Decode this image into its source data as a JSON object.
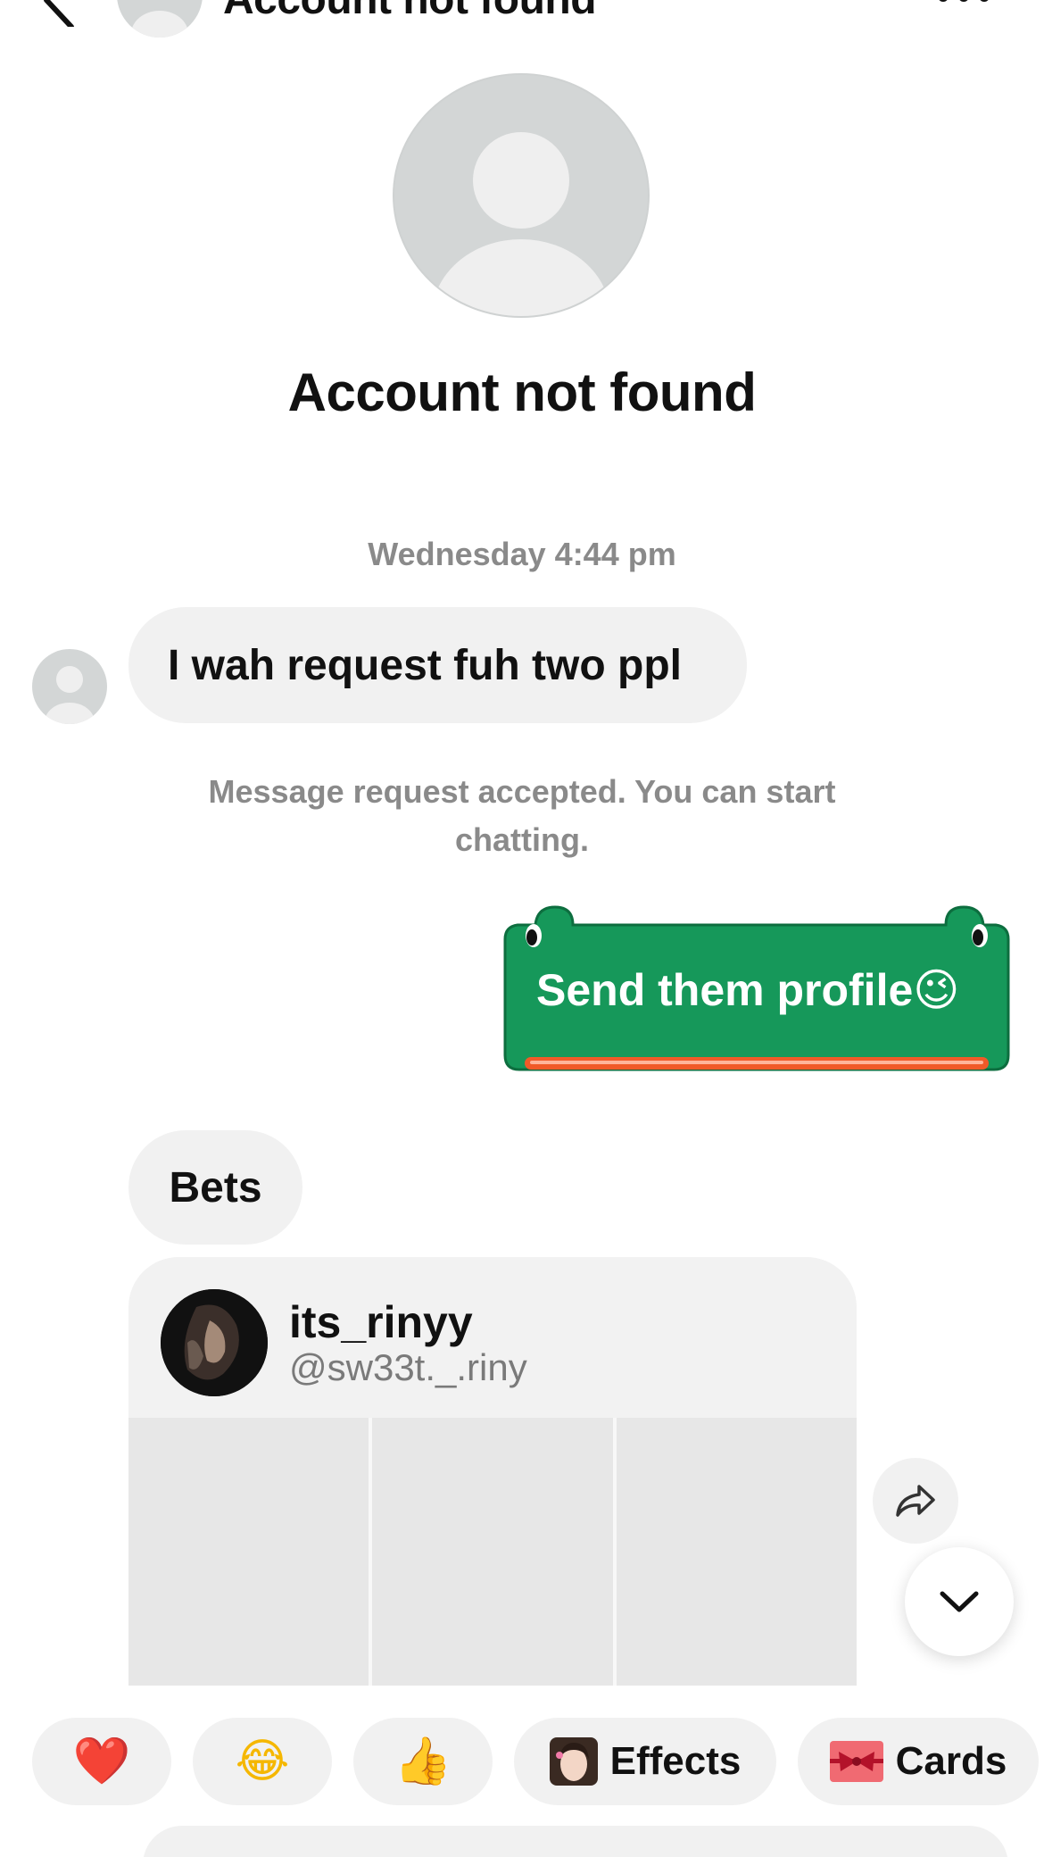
{
  "header": {
    "title": "Account not found"
  },
  "profile": {
    "name": "Account not found"
  },
  "thread": {
    "timestamp": "Wednesday 4:44 pm",
    "incoming_message": "I wah request fuh two ppl",
    "system_message": "Message request accepted. You can start chatting.",
    "sticker_text": "Send them profile😉",
    "reply_message": "Bets"
  },
  "shared_profile": {
    "display_name": "its_rinyy",
    "handle": "@sw33t._.riny"
  },
  "quick_reactions": {
    "heart": "❤️",
    "laugh": "😂",
    "thumbs_up": "👍",
    "effects_label": "Effects",
    "cards_label": "Cards"
  },
  "colors": {
    "sticker_green": "#16985a",
    "sticker_underline": "#f05a28",
    "muted_text": "#8a8a8a",
    "bubble_bg": "#f1f1f1"
  },
  "icons": [
    "back-icon",
    "more-icon",
    "share-icon",
    "chevron-down-icon",
    "effects-icon",
    "cards-icon"
  ]
}
